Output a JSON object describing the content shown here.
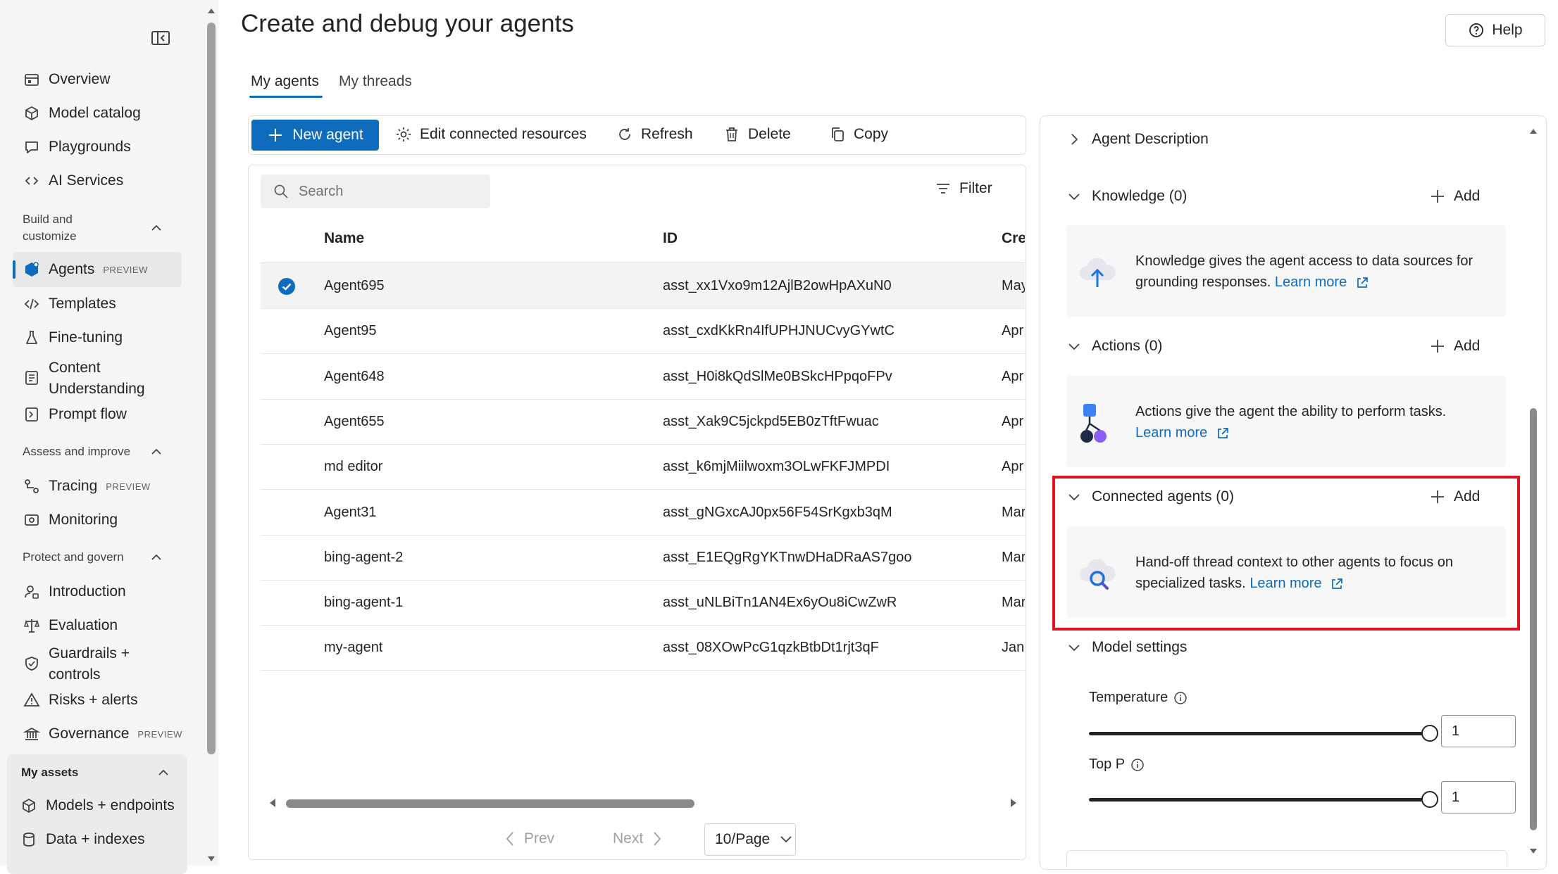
{
  "sidebar": {
    "items": {
      "overview": "Overview",
      "model_catalog": "Model catalog",
      "playgrounds": "Playgrounds",
      "ai_services": "AI Services",
      "agents": "Agents",
      "templates": "Templates",
      "fine_tuning": "Fine-tuning",
      "content_understanding_1": "Content",
      "content_understanding_2": "Understanding",
      "prompt_flow": "Prompt flow",
      "tracing": "Tracing",
      "monitoring": "Monitoring",
      "introduction": "Introduction",
      "evaluation": "Evaluation",
      "guardrails_1": "Guardrails +",
      "guardrails_2": "controls",
      "risks_alerts": "Risks + alerts",
      "governance": "Governance",
      "models_endpoints": "Models + endpoints",
      "data_indexes": "Data + indexes"
    },
    "sections": {
      "build_1": "Build and",
      "build_2": "customize",
      "assess": "Assess and improve",
      "protect": "Protect and govern",
      "my_assets": "My assets"
    },
    "preview_badge": "PREVIEW"
  },
  "header": {
    "title": "Create and debug your agents",
    "help": "Help"
  },
  "tabs": [
    "My agents",
    "My threads"
  ],
  "toolbar": {
    "new_agent": "New agent",
    "edit_connected": "Edit connected resources",
    "refresh": "Refresh",
    "delete": "Delete",
    "copy": "Copy"
  },
  "table": {
    "search_placeholder": "Search",
    "filter": "Filter",
    "columns": [
      "Name",
      "ID",
      "Crea"
    ],
    "rows": [
      {
        "name": "Agent695",
        "id": "asst_xx1Vxo9m12AjlB2owHpAXuN0",
        "created": "May",
        "selected": true
      },
      {
        "name": "Agent95",
        "id": "asst_cxdKkRn4IfUPHJNUCvyGYwtC",
        "created": "Apr"
      },
      {
        "name": "Agent648",
        "id": "asst_H0i8kQdSlMe0BSkcHPpqoFPv",
        "created": "Apr"
      },
      {
        "name": "Agent655",
        "id": "asst_Xak9C5jckpd5EB0zTftFwuac",
        "created": "Apr"
      },
      {
        "name": "md editor",
        "id": "asst_k6mjMiilwoxm3OLwFKFJMPDI",
        "created": "Apr"
      },
      {
        "name": "Agent31",
        "id": "asst_gNGxcAJ0px56F54SrKgxb3qM",
        "created": "Mar"
      },
      {
        "name": "bing-agent-2",
        "id": "asst_E1EQgRgYKTnwDHaDRaAS7goo",
        "created": "Mar"
      },
      {
        "name": "bing-agent-1",
        "id": "asst_uNLBiTn1AN4Ex6yOu8iCwZwR",
        "created": "Mar"
      },
      {
        "name": "my-agent",
        "id": "asst_08XOwPcG1qzkBtbDt1rjt3qF",
        "created": "Jan"
      }
    ]
  },
  "pager": {
    "prev": "Prev",
    "next": "Next",
    "per_page": "10/Page"
  },
  "panel": {
    "agent_description": "Agent Description",
    "knowledge": "Knowledge (0)",
    "knowledge_text_1": "Knowledge gives the agent access to data sources for",
    "knowledge_text_2": "grounding responses.",
    "actions": "Actions (0)",
    "actions_text_1": "Actions give the agent the ability to perform tasks.",
    "connected_agents": "Connected agents (0)",
    "connected_text_1": "Hand-off thread context to other agents to focus on",
    "connected_text_2": "specialized tasks.",
    "learn_more": "Learn more",
    "add": "Add",
    "model_settings": "Model settings",
    "temperature_label": "Temperature",
    "temperature_value": "1",
    "top_p_label": "Top P",
    "top_p_value": "1"
  },
  "colors": {
    "accent": "#0f6cbd",
    "highlight": "#e0141e"
  }
}
